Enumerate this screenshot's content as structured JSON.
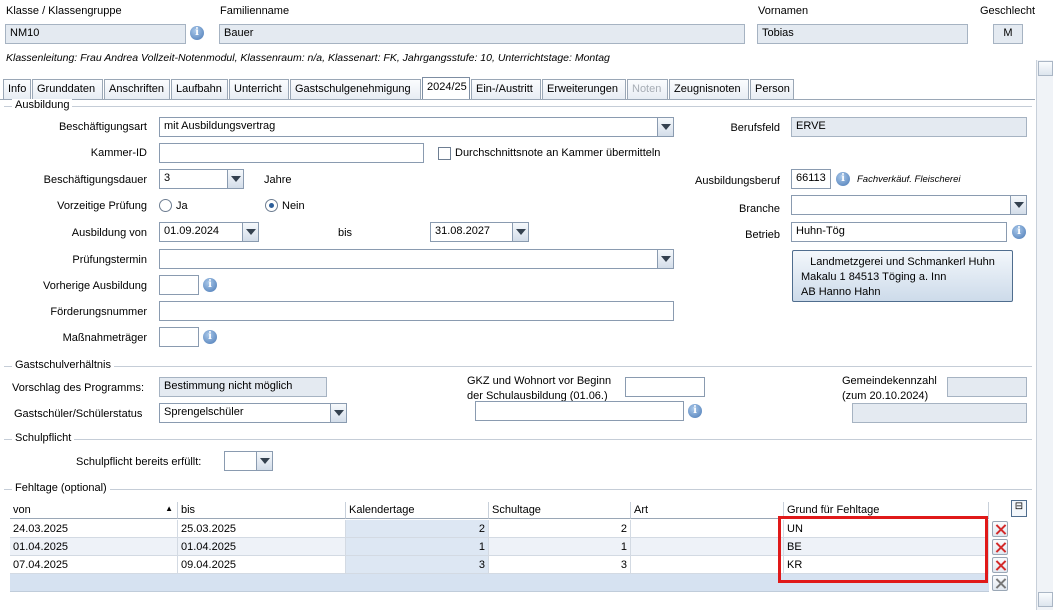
{
  "header": {
    "klasse_label": "Klasse / Klassengruppe",
    "klasse_value": "NM10",
    "familienname_label": "Familienname",
    "familienname_value": "Bauer",
    "vornamen_label": "Vornamen",
    "vornamen_value": "Tobias",
    "geschlecht_label": "Geschlecht",
    "geschlecht_value": "M",
    "info_line": "Klassenleitung: Frau Andrea Vollzeit-Notenmodul, Klassenraum: n/a, Klassenart: FK, Jahrgangsstufe: 10, Unterrichtstage: Montag"
  },
  "tabs": [
    {
      "label": "Info"
    },
    {
      "label": "Grunddaten"
    },
    {
      "label": "Anschriften"
    },
    {
      "label": "Laufbahn"
    },
    {
      "label": "Unterricht"
    },
    {
      "label": "Gastschulgenehmigung"
    },
    {
      "label": "2024/25"
    },
    {
      "label": "Ein-/Austritt"
    },
    {
      "label": "Erweiterungen"
    },
    {
      "label": "Noten"
    },
    {
      "label": "Zeugnisnoten"
    },
    {
      "label": "Person"
    }
  ],
  "ausbildung": {
    "section_title": "Ausbildung",
    "beschaeftigungsart_label": "Beschäftigungsart",
    "beschaeftigungsart_value": "mit Ausbildungsvertrag",
    "kammer_label": "Kammer-ID",
    "kammer_value": "",
    "durchschnitt_label": "Durchschnittsnote an Kammer übermitteln",
    "dauer_label": "Beschäftigungsdauer",
    "dauer_value": "3",
    "dauer_unit": "Jahre",
    "vorzeitig_label": "Vorzeitige Prüfung",
    "radio_ja": "Ja",
    "radio_nein": "Nein",
    "von_label": "Ausbildung von",
    "von_value": "01.09.2024",
    "bis_label": "bis",
    "bis_value": "31.08.2027",
    "pruefung_label": "Prüfungstermin",
    "vorherige_label": "Vorherige Ausbildung",
    "foerder_label": "Förderungsnummer",
    "massnahme_label": "Maßnahmeträger",
    "berufsfeld_label": "Berufsfeld",
    "berufsfeld_value": "ERVE",
    "beruf_label": "Ausbildungsberuf",
    "beruf_code": "66113",
    "beruf_text": "Fachverkäuf. Fleischerei",
    "branche_label": "Branche",
    "branche_value": "",
    "betrieb_label": "Betrieb",
    "betrieb_value": "Huhn-Tög",
    "betrieb_line1": "Landmetzgerei und Schmankerl Huhn",
    "betrieb_line2": "Makalu 1 84513 Töging a. Inn",
    "betrieb_line3": "AB Hanno Hahn"
  },
  "gastschul": {
    "section_title": "Gastschulverhältnis",
    "vorschlag_label": "Vorschlag des Programms:",
    "vorschlag_value": "Bestimmung nicht möglich",
    "status_label": "Gastschüler/Schülerstatus",
    "status_value": "Sprengelschüler",
    "gkz_label_1": "GKZ und Wohnort vor Beginn",
    "gkz_label_2": "der Schulausbildung (01.06.)",
    "gemeinde_label_1": "Gemeindekennzahl",
    "gemeinde_label_2": "(zum 20.10.2024)"
  },
  "schulpflicht": {
    "section_title": "Schulpflicht",
    "erfuellt_label": "Schulpflicht bereits erfüllt:"
  },
  "fehltage": {
    "section_title": "Fehltage (optional)",
    "columns": [
      "von",
      "bis",
      "Kalendertage",
      "Schultage",
      "Art",
      "Grund für Fehltage"
    ],
    "rows": [
      {
        "von": "24.03.2025",
        "bis": "25.03.2025",
        "kalendertage": "2",
        "schultage": "2",
        "art": "",
        "grund": "UN"
      },
      {
        "von": "01.04.2025",
        "bis": "01.04.2025",
        "kalendertage": "1",
        "schultage": "1",
        "art": "",
        "grund": "BE"
      },
      {
        "von": "07.04.2025",
        "bis": "09.04.2025",
        "kalendertage": "3",
        "schultage": "3",
        "art": "",
        "grund": "KR"
      }
    ]
  },
  "colors": {
    "highlight": "#e01919",
    "accent": "#2d5f9a"
  }
}
